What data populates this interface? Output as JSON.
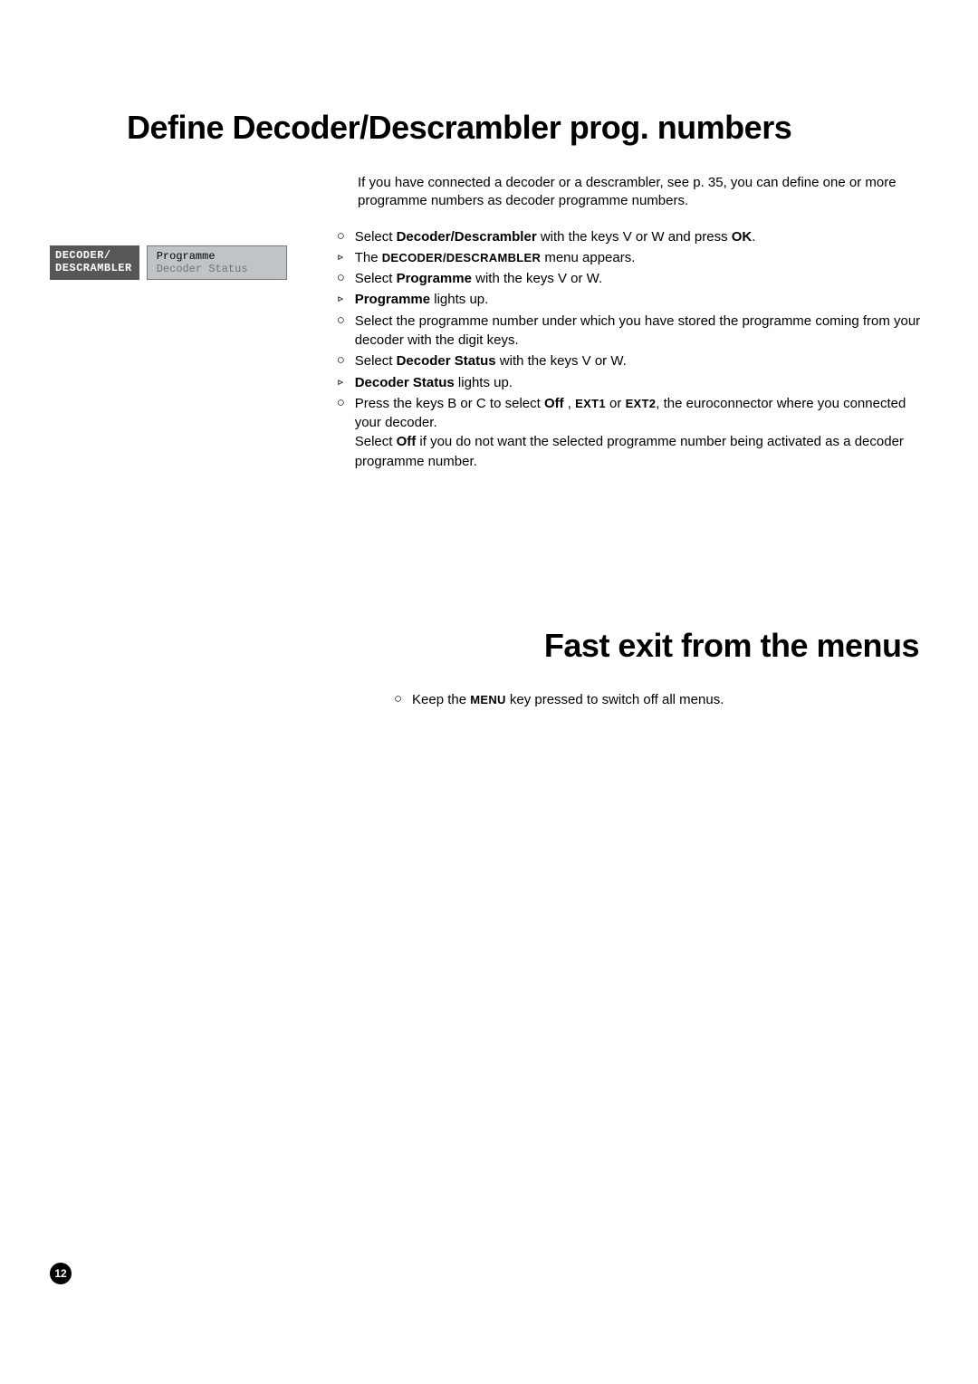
{
  "title1": "Define Decoder/Descrambler prog. numbers",
  "title2": "Fast exit from the menus",
  "intro": "If you have connected a decoder or a descrambler, see p. 35, you can define one or more programme numbers as decoder programme numbers.",
  "menu": {
    "header1": "DECODER/",
    "header2": "DESCRAMBLER",
    "item1": "Programme",
    "item2": "Decoder Status"
  },
  "bullets": {
    "circle": "○",
    "triangle": "▹"
  },
  "steps": {
    "s1a_pre": "Select ",
    "s1a_bold": "Decoder/Descrambler",
    "s1a_mid": " with the keys V  or W and press ",
    "s1a_ok": "OK",
    "s1a_end": ".",
    "s1b_pre": "The ",
    "s1b_sc": "DECODER/DESCRAMBLER",
    "s1b_end": " menu appears.",
    "s2a_pre": "Select ",
    "s2a_bold": "Programme",
    "s2a_end": " with the keys V  or W.",
    "s2b_bold": "Programme",
    "s2b_end": " lights up.",
    "s2c": "Select the programme number under which you have stored the programme coming from your decoder with the digit keys.",
    "s2d_pre": "Select ",
    "s2d_bold": "Decoder Status",
    "s2d_end": " with the keys V  or W.",
    "s2e_bold": "Decoder Status",
    "s2e_end": " lights up.",
    "s2f_pre": "Press the keys B  or C  to select ",
    "s2f_off": "Off",
    "s2f_sep1": " , ",
    "s2f_ext1": "EXT1",
    "s2f_or": " or ",
    "s2f_ext2": "EXT2",
    "s2f_end": ", the euroconnector where you connected your decoder.",
    "s2g_pre": "Select ",
    "s2g_off": "Off",
    "s2g_end": " if you do not want the selected programme number being activated as a decoder programme number."
  },
  "fastexit": {
    "pre": "Keep the ",
    "menu": "MENU",
    "end": " key pressed to switch off all menus."
  },
  "pageNumber": "12"
}
